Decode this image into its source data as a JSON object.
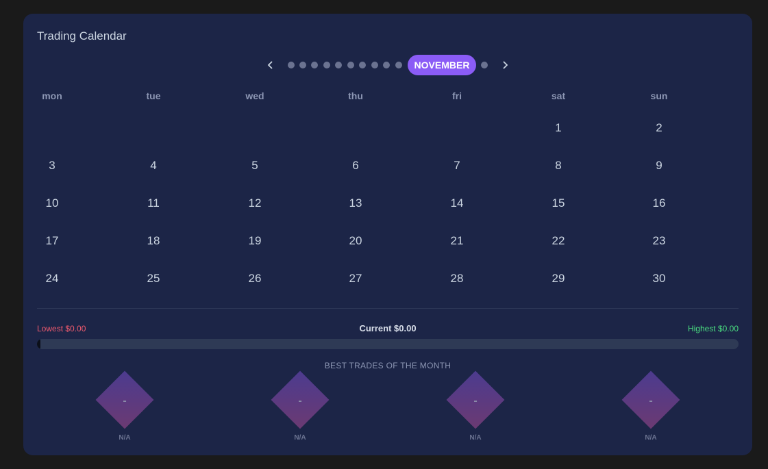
{
  "title": "Trading Calendar",
  "nav": {
    "month": "NOVEMBER",
    "prev_icon": "chevron-left-icon",
    "next_icon": "chevron-right-icon"
  },
  "weekdays": [
    "mon",
    "tue",
    "wed",
    "thu",
    "fri",
    "sat",
    "sun"
  ],
  "days": {
    "d1": "1",
    "d2": "2",
    "d3": "3",
    "d4": "4",
    "d5": "5",
    "d6": "6",
    "d7": "7",
    "d8": "8",
    "d9": "9",
    "d10": "10",
    "d11": "11",
    "d12": "12",
    "d13": "13",
    "d14": "14",
    "d15": "15",
    "d16": "16",
    "d17": "17",
    "d18": "18",
    "d19": "19",
    "d20": "20",
    "d21": "21",
    "d22": "22",
    "d23": "23",
    "d24": "24",
    "d25": "25",
    "d26": "26",
    "d27": "27",
    "d28": "28",
    "d29": "29",
    "d30": "30"
  },
  "range": {
    "lowest": "Lowest $0.00",
    "current": "Current $0.00",
    "highest": "Highest $0.00",
    "progress_fraction": 0
  },
  "best_trades": {
    "title": "BEST TRADES OF THE MONTH",
    "items": [
      {
        "value": "-",
        "label": "N/A"
      },
      {
        "value": "-",
        "label": "N/A"
      },
      {
        "value": "-",
        "label": "N/A"
      },
      {
        "value": "-",
        "label": "N/A"
      }
    ]
  },
  "colors": {
    "card_bg": "#1c2547",
    "accent": "#8b5cf6",
    "lowest": "#f05a6e",
    "highest": "#4ade80"
  }
}
